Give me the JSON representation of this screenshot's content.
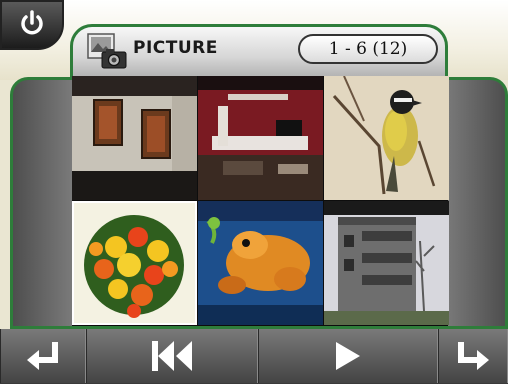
{
  "header": {
    "title": "PICTURE",
    "page_counter": "1 - 6 (12)"
  },
  "icons": {
    "power": "power-icon",
    "picture": "picture-folder-icon",
    "back": "return-arrow-icon",
    "previous": "skip-previous-icon",
    "play": "play-icon",
    "next": "turn-right-arrow-icon"
  },
  "gallery": {
    "thumbnails": [
      {
        "subject": "two paintings on a white wall"
      },
      {
        "subject": "living room with red wall"
      },
      {
        "subject": "bird on a branch"
      },
      {
        "subject": "flower bouquet"
      },
      {
        "subject": "orange cartoon animal artwork"
      },
      {
        "subject": "apartment building with balconies"
      }
    ],
    "selected_index": 3
  },
  "colors": {
    "accent_border": "#2e7d3a",
    "frame": "#6f6f6f",
    "background": "#eae6d2"
  }
}
